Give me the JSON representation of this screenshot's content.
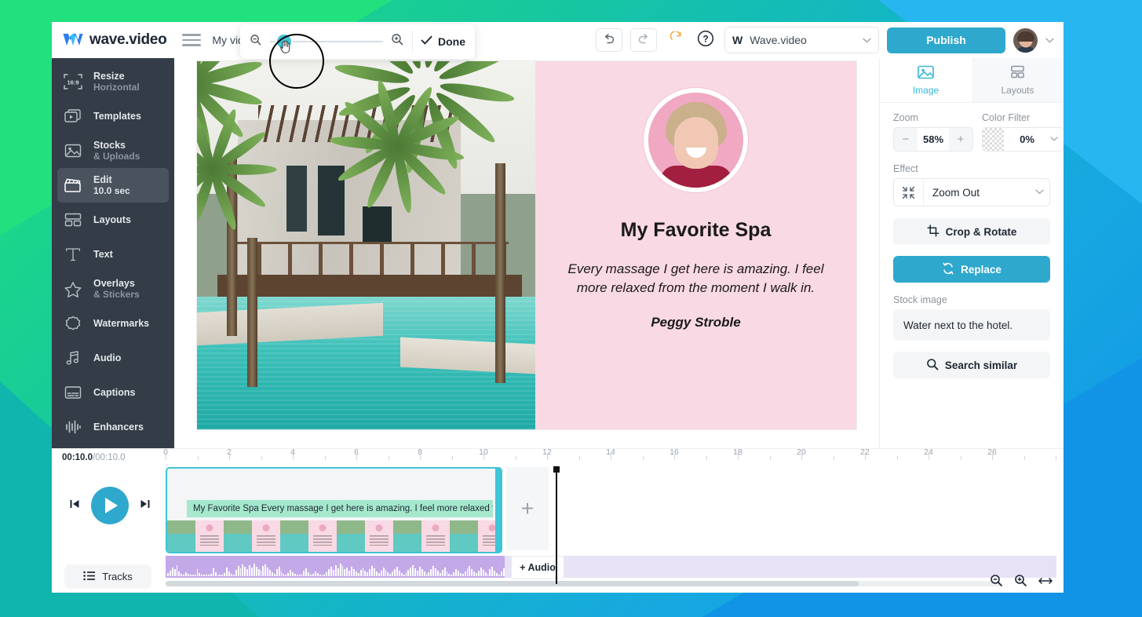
{
  "app": {
    "brand": "wave.video",
    "project_name": "My vide"
  },
  "header": {
    "hamburger_icon": "hamburger-menu-icon",
    "zoom_popover": {
      "zoom_out_icon": "magnifier-minus-icon",
      "zoom_in_icon": "magnifier-plus-icon",
      "done_label": "Done",
      "check_icon": "check-icon",
      "cursor_icon": "hand-cursor-icon"
    },
    "undo_icon": "undo-arrow-icon",
    "redo_icon": "redo-arrow-icon",
    "refresh_icon": "refresh-icon",
    "help_icon": "question-mark-icon",
    "brand_select": {
      "badge": "W",
      "value": "Wave.video",
      "chevron": "chevron-down-icon"
    },
    "publish_label": "Publish",
    "avatar_chevron": "chevron-down-icon"
  },
  "sidebar": {
    "items": [
      {
        "label": "Resize",
        "sub": "Horizontal",
        "icon": "resize-16-9-icon",
        "active": false
      },
      {
        "label": "Templates",
        "sub": "",
        "icon": "templates-icon",
        "active": false
      },
      {
        "label": "Stocks",
        "sub": "& Uploads",
        "icon": "image-icon",
        "active": false
      },
      {
        "label": "Edit",
        "sub": "10.0 sec",
        "icon": "clapperboard-icon",
        "active": true
      },
      {
        "label": "Layouts",
        "sub": "",
        "icon": "layouts-icon",
        "active": false
      },
      {
        "label": "Text",
        "sub": "",
        "icon": "text-t-icon",
        "active": false
      },
      {
        "label": "Overlays",
        "sub": "& Stickers",
        "icon": "star-icon",
        "active": false
      },
      {
        "label": "Watermarks",
        "sub": "",
        "icon": "badge-seal-icon",
        "active": false
      },
      {
        "label": "Audio",
        "sub": "",
        "icon": "music-note-icon",
        "active": false
      },
      {
        "label": "Captions",
        "sub": "",
        "icon": "captions-icon",
        "active": false
      },
      {
        "label": "Enhancers",
        "sub": "",
        "icon": "waveform-icon",
        "active": false
      }
    ]
  },
  "canvas": {
    "title": "My Favorite Spa",
    "quote": "Every massage I get here is amazing. I feel more relaxed from the moment I walk in.",
    "author": "Peggy Stroble",
    "photo_alt": "smiling-woman-portrait",
    "image_alt": "pool-and-palm-trees-photo",
    "card_bg": "#f9d9e4"
  },
  "right_panel": {
    "tabs": [
      {
        "label": "Image",
        "icon": "image-icon",
        "active": true
      },
      {
        "label": "Layouts",
        "icon": "layouts-icon",
        "active": false
      }
    ],
    "zoom_label": "Zoom",
    "zoom_value": "58%",
    "zoom_minus": "−",
    "zoom_plus": "+",
    "color_filter_label": "Color Filter",
    "color_filter_value": "0%",
    "effect_label": "Effect",
    "effect_value": "Zoom Out",
    "effect_icon": "zoom-out-arrows-icon",
    "crop_rotate_label": "Crop & Rotate",
    "crop_icon": "crop-icon",
    "replace_label": "Replace",
    "replace_icon": "replace-circular-arrows-icon",
    "stock_image_label": "Stock image",
    "stock_image_value": "Water next to the hotel.",
    "search_similar_label": "Search similar",
    "search_icon": "magnifier-icon",
    "accent_color": "#2fa8cd"
  },
  "timeline": {
    "current_time": "00:10.0",
    "total_time": "/00:10.0",
    "ruler_ticks": [
      0,
      2,
      4,
      6,
      8,
      10,
      12,
      14,
      16,
      18,
      20,
      22,
      24,
      26
    ],
    "playhead_at": "10",
    "caption_text": "My Favorite Spa Every massage I get here is amazing. I feel more relaxed from",
    "add_clip_label": "+",
    "add_audio_label": "+ Audio",
    "tracks_label": "Tracks",
    "tracks_icon": "list-icon",
    "prev_icon": "skip-previous-icon",
    "play_icon": "play-icon",
    "next_icon": "skip-next-icon",
    "zoom_out_icon": "magnifier-minus-icon",
    "zoom_in_icon": "magnifier-plus-icon",
    "fit_icon": "fit-width-arrows-icon"
  }
}
